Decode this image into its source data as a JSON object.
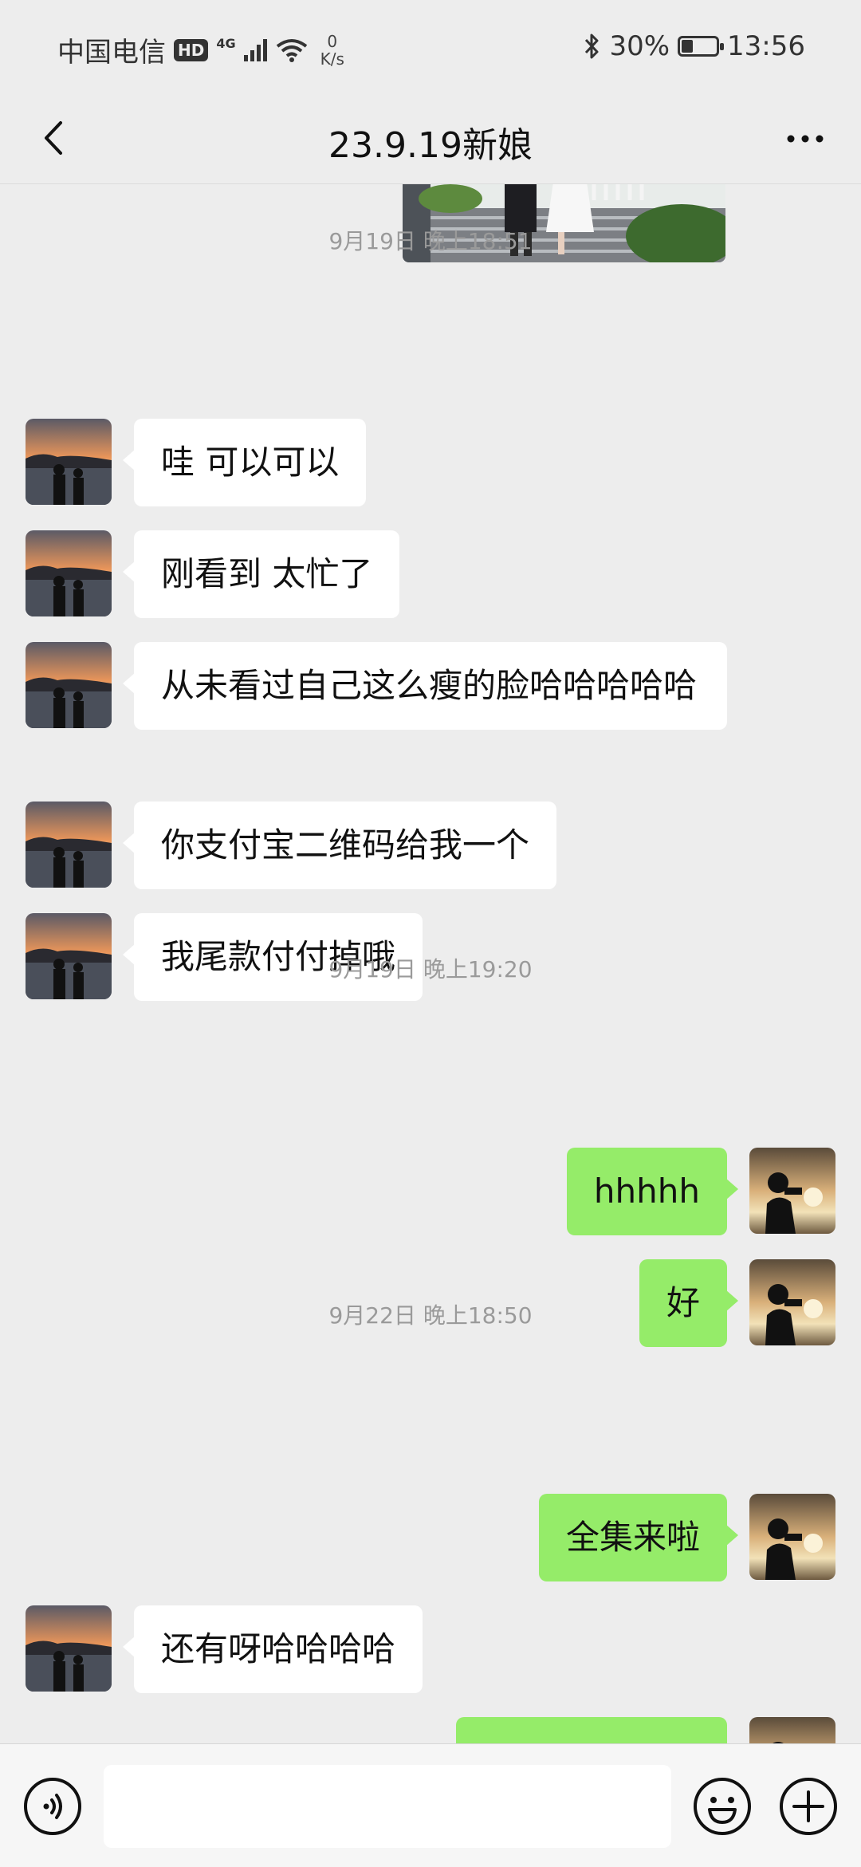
{
  "status_bar": {
    "carrier": "中国电信",
    "hd": "HD",
    "network": "4G",
    "speed_value": "0",
    "speed_unit": "K/s",
    "battery": "30%",
    "battery_level": 0.3,
    "time": "13:56"
  },
  "header": {
    "title": "23.9.19新娘"
  },
  "timestamps": [
    "9月19日 晚上18:51",
    "9月19日 晚上19:20",
    "9月22日 晚上18:50"
  ],
  "messages": [
    {
      "side": "left",
      "text": "哇 可以可以"
    },
    {
      "side": "left",
      "text": "刚看到 太忙了"
    },
    {
      "side": "left",
      "text": "从未看过自己这么瘦的脸哈哈哈哈哈"
    },
    {
      "side": "left",
      "text": "你支付宝二维码给我一个"
    },
    {
      "side": "left",
      "text": "我尾款付付掉哦"
    },
    {
      "side": "right",
      "text": "hhhhh"
    },
    {
      "side": "right",
      "text": "好"
    },
    {
      "side": "right",
      "text": "全集来啦"
    },
    {
      "side": "left",
      "text": "还有呀哈哈哈哈"
    },
    {
      "side": "right",
      "text": ""
    }
  ],
  "input": {
    "placeholder": "",
    "value": ""
  },
  "colors": {
    "background": "#ededed",
    "sent_bubble": "#95ec69",
    "received_bubble": "#ffffff",
    "timestamp": "#9a9a9a"
  },
  "icons": {
    "back": "chevron-left-icon",
    "more": "more-icon",
    "voice": "voice-icon",
    "emoji": "emoji-icon",
    "plus": "plus-icon"
  }
}
